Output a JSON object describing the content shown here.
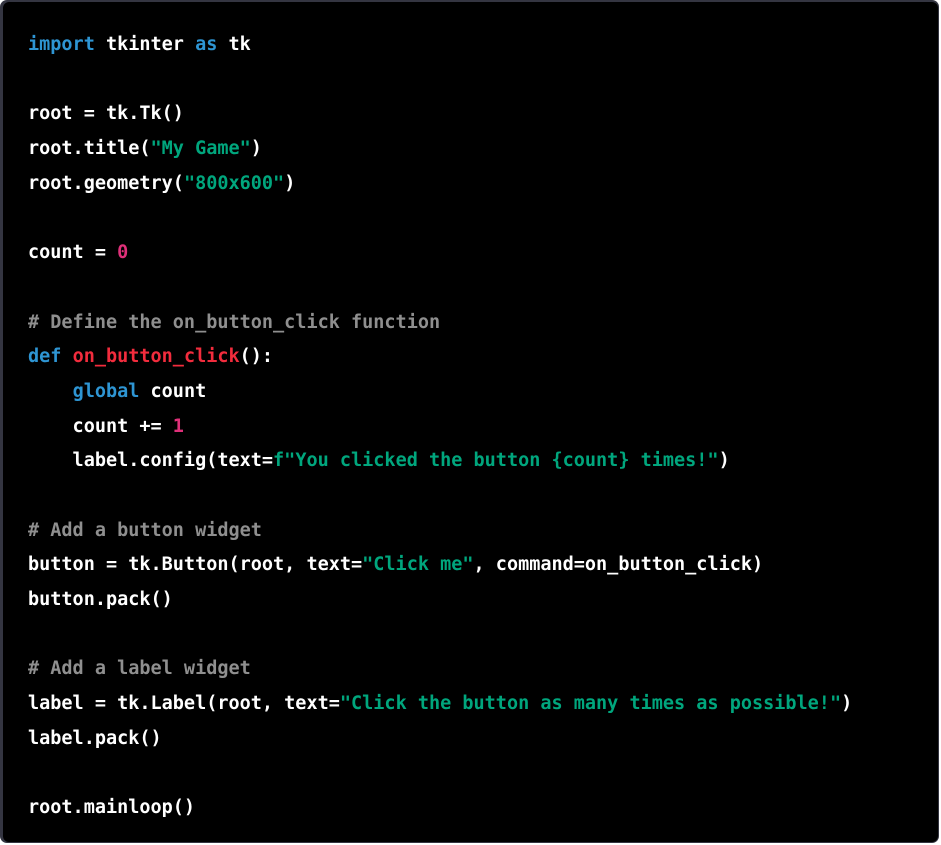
{
  "code_block": {
    "language": "python",
    "lines": [
      [
        {
          "t": "import",
          "c": "kw"
        },
        {
          "t": " tkinter "
        },
        {
          "t": "as",
          "c": "kw"
        },
        {
          "t": " tk"
        }
      ],
      [],
      [
        {
          "t": "root = tk.Tk()"
        }
      ],
      [
        {
          "t": "root.title("
        },
        {
          "t": "\"My Game\"",
          "c": "str"
        },
        {
          "t": ")"
        }
      ],
      [
        {
          "t": "root.geometry("
        },
        {
          "t": "\"800x600\"",
          "c": "str"
        },
        {
          "t": ")"
        }
      ],
      [],
      [
        {
          "t": "count = "
        },
        {
          "t": "0",
          "c": "num"
        }
      ],
      [],
      [
        {
          "t": "# Define the on_button_click function",
          "c": "cm"
        }
      ],
      [
        {
          "t": "def",
          "c": "kw"
        },
        {
          "t": " "
        },
        {
          "t": "on_button_click",
          "c": "fn"
        },
        {
          "t": "():"
        }
      ],
      [
        {
          "t": "    "
        },
        {
          "t": "global",
          "c": "kw"
        },
        {
          "t": " count"
        }
      ],
      [
        {
          "t": "    count += "
        },
        {
          "t": "1",
          "c": "num"
        }
      ],
      [
        {
          "t": "    label.config(text="
        },
        {
          "t": "f\"You clicked the button {count} times!\"",
          "c": "str"
        },
        {
          "t": ")"
        }
      ],
      [],
      [
        {
          "t": "# Add a button widget",
          "c": "cm"
        }
      ],
      [
        {
          "t": "button = tk.Button(root, text="
        },
        {
          "t": "\"Click me\"",
          "c": "str"
        },
        {
          "t": ", command=on_button_click)"
        }
      ],
      [
        {
          "t": "button.pack()"
        }
      ],
      [],
      [
        {
          "t": "# Add a label widget",
          "c": "cm"
        }
      ],
      [
        {
          "t": "label = tk.Label(root, text="
        },
        {
          "t": "\"Click the button as many times as possible!\"",
          "c": "str"
        },
        {
          "t": ")"
        }
      ],
      [
        {
          "t": "label.pack()"
        }
      ],
      [],
      [
        {
          "t": "root.mainloop()"
        }
      ]
    ]
  },
  "colors": {
    "background": "#000000",
    "keyword": "#2e95d3",
    "string": "#00a67d",
    "number": "#df3079",
    "function": "#f22c3d",
    "comment": "#8f8f8f",
    "text": "#ffffff"
  }
}
